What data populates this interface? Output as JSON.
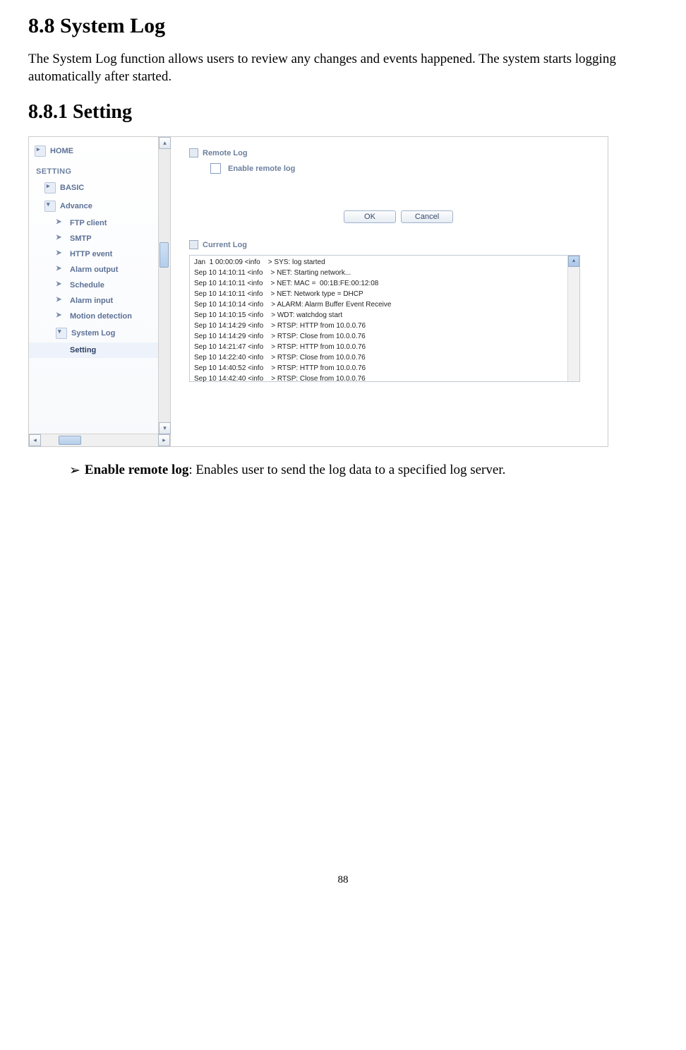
{
  "heading1": "8.8 System Log",
  "paragraph1": "The System Log function allows users to review any changes and events happened. The system starts logging automatically after started.",
  "heading2": "8.8.1 Setting",
  "sidebar": {
    "home": "HOME",
    "section": "SETTING",
    "basic": "BASIC",
    "advance": "Advance",
    "items": {
      "ftp": "FTP client",
      "smtp": "SMTP",
      "http": "HTTP event",
      "alarm_out": "Alarm output",
      "schedule": "Schedule",
      "alarm_in": "Alarm input",
      "motion": "Motion detection",
      "syslog": "System Log",
      "setting": "Setting"
    }
  },
  "main": {
    "remote_log": "Remote Log",
    "enable_remote": "Enable remote log",
    "ok": "OK",
    "cancel": "Cancel",
    "current_log": "Current Log"
  },
  "log": [
    "Jan  1 00:00:09 <info    > SYS: log started",
    "Sep 10 14:10:11 <info    > NET: Starting network...",
    "Sep 10 14:10:11 <info    > NET: MAC =  00:1B:FE:00:12:08",
    "Sep 10 14:10:11 <info    > NET: Network type = DHCP",
    "Sep 10 14:10:14 <info    > ALARM: Alarm Buffer Event Receive",
    "Sep 10 14:10:15 <info    > WDT: watchdog start",
    "Sep 10 14:14:29 <info    > RTSP: HTTP from 10.0.0.76",
    "Sep 10 14:14:29 <info    > RTSP: Close from 10.0.0.76",
    "Sep 10 14:21:47 <info    > RTSP: HTTP from 10.0.0.76",
    "Sep 10 14:22:40 <info    > RTSP: Close from 10.0.0.76",
    "Sep 10 14:40:52 <info    > RTSP: HTTP from 10.0.0.76",
    "Sep 10 14:42:40 <info    > RTSP: Close from 10.0.0.76"
  ],
  "bullet": {
    "symbol": "➢",
    "bold": "Enable remote log",
    "rest": ": Enables user to send the log data to a specified log server."
  },
  "page_number": "88"
}
